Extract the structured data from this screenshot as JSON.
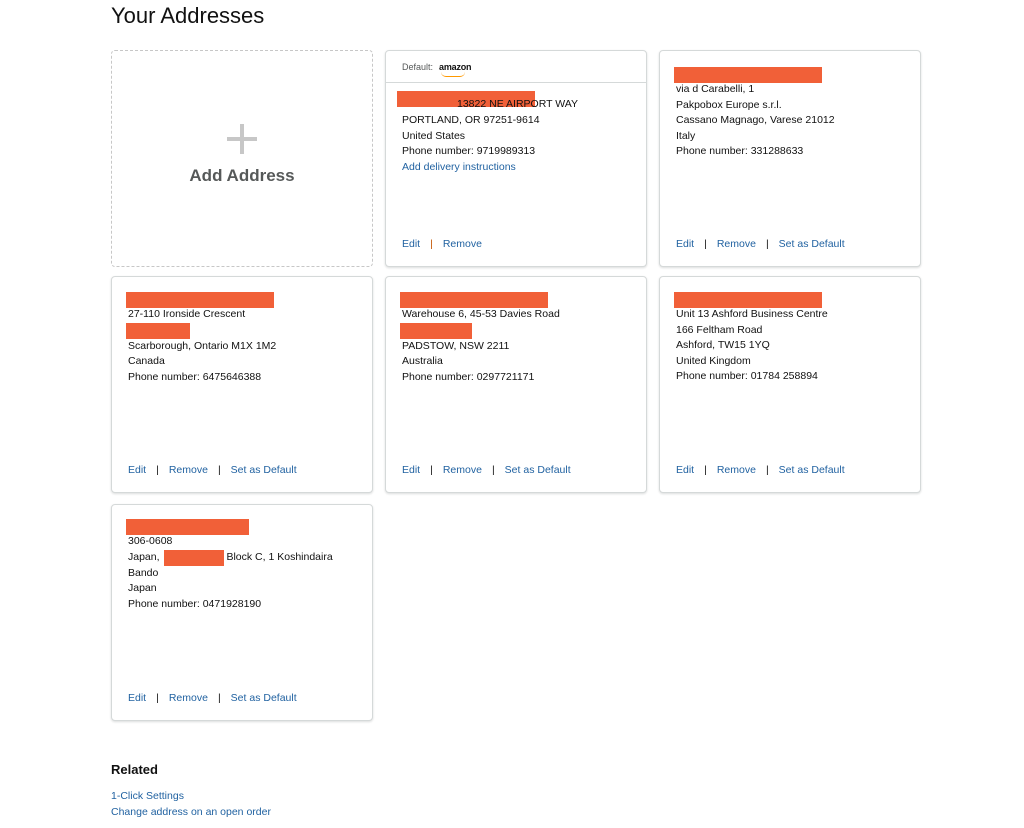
{
  "page": {
    "title": "Your Addresses"
  },
  "add_card": {
    "label": "Add Address"
  },
  "actions": {
    "edit": "Edit",
    "remove": "Remove",
    "set_default": "Set as Default",
    "separator": "|"
  },
  "default_card": {
    "default_label": "Default:",
    "logo_text": "amazon",
    "line1_suffix": "13822 NE AIRPORT WAY",
    "line2": "PORTLAND, OR 97251-9614",
    "line3": "United States",
    "phone": "Phone number: 9719989313",
    "delivery_link": "Add delivery instructions"
  },
  "italy_card": {
    "line1": "via d Carabelli, 1",
    "line2": "Pakpobox Europe s.r.l.",
    "line3": "Cassano Magnago, Varese 21012",
    "line4": "Italy",
    "phone": "Phone number: 331288633"
  },
  "canada_card": {
    "line1": "27-110 Ironside Crescent",
    "line2": "Scarborough, Ontario M1X 1M2",
    "line3": "Canada",
    "phone": "Phone number: 6475646388"
  },
  "australia_card": {
    "line1": "Warehouse 6, 45-53 Davies Road",
    "line2": "PADSTOW, NSW 2211",
    "line3": "Australia",
    "phone": "Phone number: 0297721171"
  },
  "uk_card": {
    "line1": "Unit 13 Ashford Business Centre",
    "line2": "166 Feltham Road",
    "line3": "Ashford, TW15 1YQ",
    "line4": "United Kingdom",
    "phone": "Phone number: 01784 258894"
  },
  "japan_card": {
    "line1": "306-0608",
    "line2_prefix": "Japan,",
    "line2_suffix": "Block C, 1 Koshindaira",
    "line3": "Bando",
    "line4": "Japan",
    "phone": "Phone number: 0471928190"
  },
  "related": {
    "title": "Related",
    "links": [
      "1-Click Settings",
      "Change address on an open order"
    ]
  },
  "colors": {
    "redaction": "#f16038",
    "link": "#2162a1",
    "separator_accent": "#c45500",
    "card_border": "#d5d9d9"
  }
}
